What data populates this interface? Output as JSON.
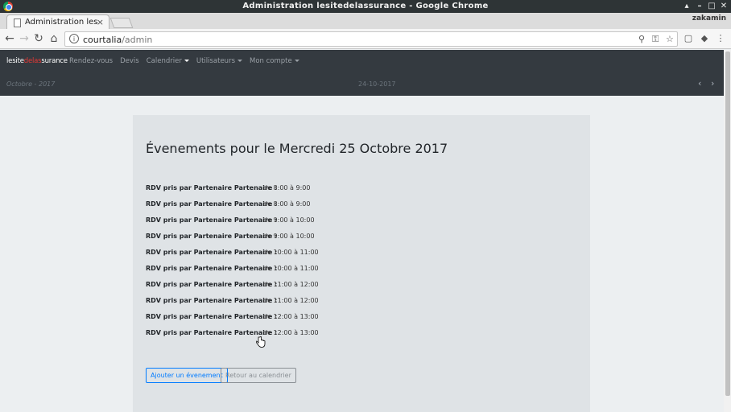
{
  "window": {
    "title": "Administration lesitedelassurance - Google Chrome",
    "profile": "zakamin"
  },
  "tabs": [
    {
      "title": "Administration lesite",
      "close": "×"
    }
  ],
  "addressbar": {
    "host": "courtalia",
    "path": "/admin"
  },
  "app": {
    "brand": {
      "part1": "lesite",
      "part2": "delas",
      "part3": "surance"
    },
    "nav": [
      {
        "label": "Rendez-vous",
        "active": false,
        "dropdown": false
      },
      {
        "label": "Devis",
        "active": false,
        "dropdown": false
      },
      {
        "label": "Calendrier",
        "active": true,
        "dropdown": true
      },
      {
        "label": "Utilisateurs",
        "active": false,
        "dropdown": true
      },
      {
        "label": "Mon compte",
        "active": false,
        "dropdown": true
      }
    ],
    "month_label": "Octobre - 2017",
    "date_label": "24-10-2017"
  },
  "main": {
    "heading": "Évenements pour le Mercredi 25 Octobre 2017",
    "events": [
      {
        "label": "RDV pris par Partenaire Partenaire :",
        "time": "de 8:00 à 9:00"
      },
      {
        "label": "RDV pris par Partenaire Partenaire :",
        "time": "de 8:00 à 9:00"
      },
      {
        "label": "RDV pris par Partenaire Partenaire :",
        "time": "de 9:00 à 10:00"
      },
      {
        "label": "RDV pris par Partenaire Partenaire :",
        "time": "de 9:00 à 10:00"
      },
      {
        "label": "RDV pris par Partenaire Partenaire :",
        "time": "de 10:00 à 11:00"
      },
      {
        "label": "RDV pris par Partenaire Partenaire :",
        "time": "de 10:00 à 11:00"
      },
      {
        "label": "RDV pris par Partenaire Partenaire :",
        "time": "de 11:00 à 12:00"
      },
      {
        "label": "RDV pris par Partenaire Partenaire :",
        "time": "de 11:00 à 12:00"
      },
      {
        "label": "RDV pris par Partenaire Partenaire :",
        "time": "de 12:00 à 13:00"
      },
      {
        "label": "RDV pris par Partenaire Partenaire :",
        "time": "de 12:00 à 13:00"
      }
    ],
    "add_button": "Ajouter un évenement",
    "back_button": "Retour au calendrier"
  },
  "icons": {
    "back": "arrow-left-icon",
    "forward": "arrow-right-icon",
    "reload": "reload-icon",
    "home": "home-icon",
    "info": "info-icon",
    "zoom": "zoom-icon",
    "key": "key-icon",
    "star": "star-icon",
    "prev": "chevron-left-icon",
    "next": "chevron-right-icon"
  },
  "colors": {
    "navbar": "#343a40",
    "panel": "#dfe3e6",
    "primary": "#007bff",
    "brand_accent": "#e53935"
  }
}
